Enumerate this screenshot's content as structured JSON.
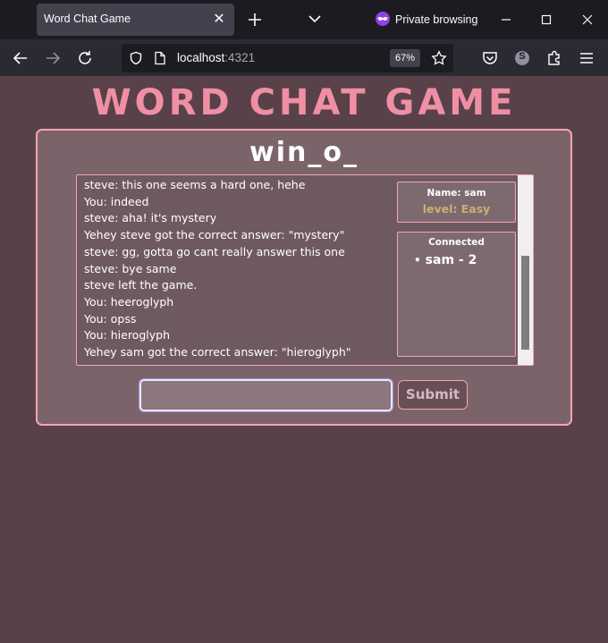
{
  "browser": {
    "tab_title": "Word Chat Game",
    "private_label": "Private browsing",
    "url_host": "localhost",
    "url_port": ":4321",
    "zoom": "67%",
    "account_initial": "S"
  },
  "page": {
    "title": "WORD CHAT GAME",
    "word_hint": "win_o_"
  },
  "chat": {
    "messages": [
      "steve: this one seems a hard one, hehe",
      "You: indeed",
      "steve: aha! it's mystery",
      "Yehey steve got the correct answer: \"mystery\"",
      "steve: gg, gotta go cant really answer this one",
      "steve: bye same",
      "steve left the game.",
      "You: heeroglyph",
      "You: opss",
      "You: hieroglyph",
      "Yehey sam got the correct answer: \"hieroglyph\""
    ]
  },
  "player": {
    "name_label": "Name: sam",
    "level_label": "level: Easy"
  },
  "connected": {
    "title": "Connected",
    "users": [
      "sam - 2"
    ]
  },
  "form": {
    "input_value": "",
    "input_placeholder": "",
    "submit_label": "Submit"
  },
  "colors": {
    "page_bg": "#594149",
    "accent_pink": "#f08fa4",
    "level_gold": "#c9b072"
  }
}
